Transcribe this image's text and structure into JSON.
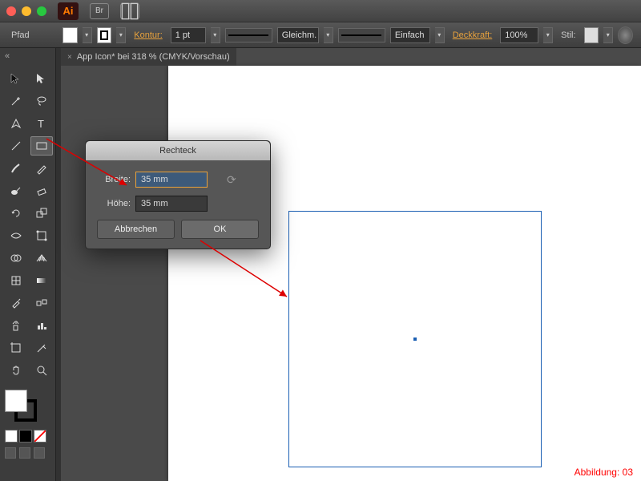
{
  "titlebar": {
    "app_abbr": "Ai"
  },
  "controlbar": {
    "path_label": "Pfad",
    "kontur_label": "Kontur:",
    "kontur_value": "1 pt",
    "cap_label": "Gleichm.",
    "profile_label": "Einfach",
    "deckkraft_label": "Deckkraft:",
    "deckkraft_value": "100%",
    "stil_label": "Stil:"
  },
  "document": {
    "tab_label": "App Icon* bei 318 % (CMYK/Vorschau)"
  },
  "dialog": {
    "title": "Rechteck",
    "breite_label": "Breite:",
    "breite_value": "35 mm",
    "hoehe_label": "Höhe:",
    "hoehe_value": "35 mm",
    "cancel_label": "Abbrechen",
    "ok_label": "OK"
  },
  "caption": "Abbildung: 03"
}
